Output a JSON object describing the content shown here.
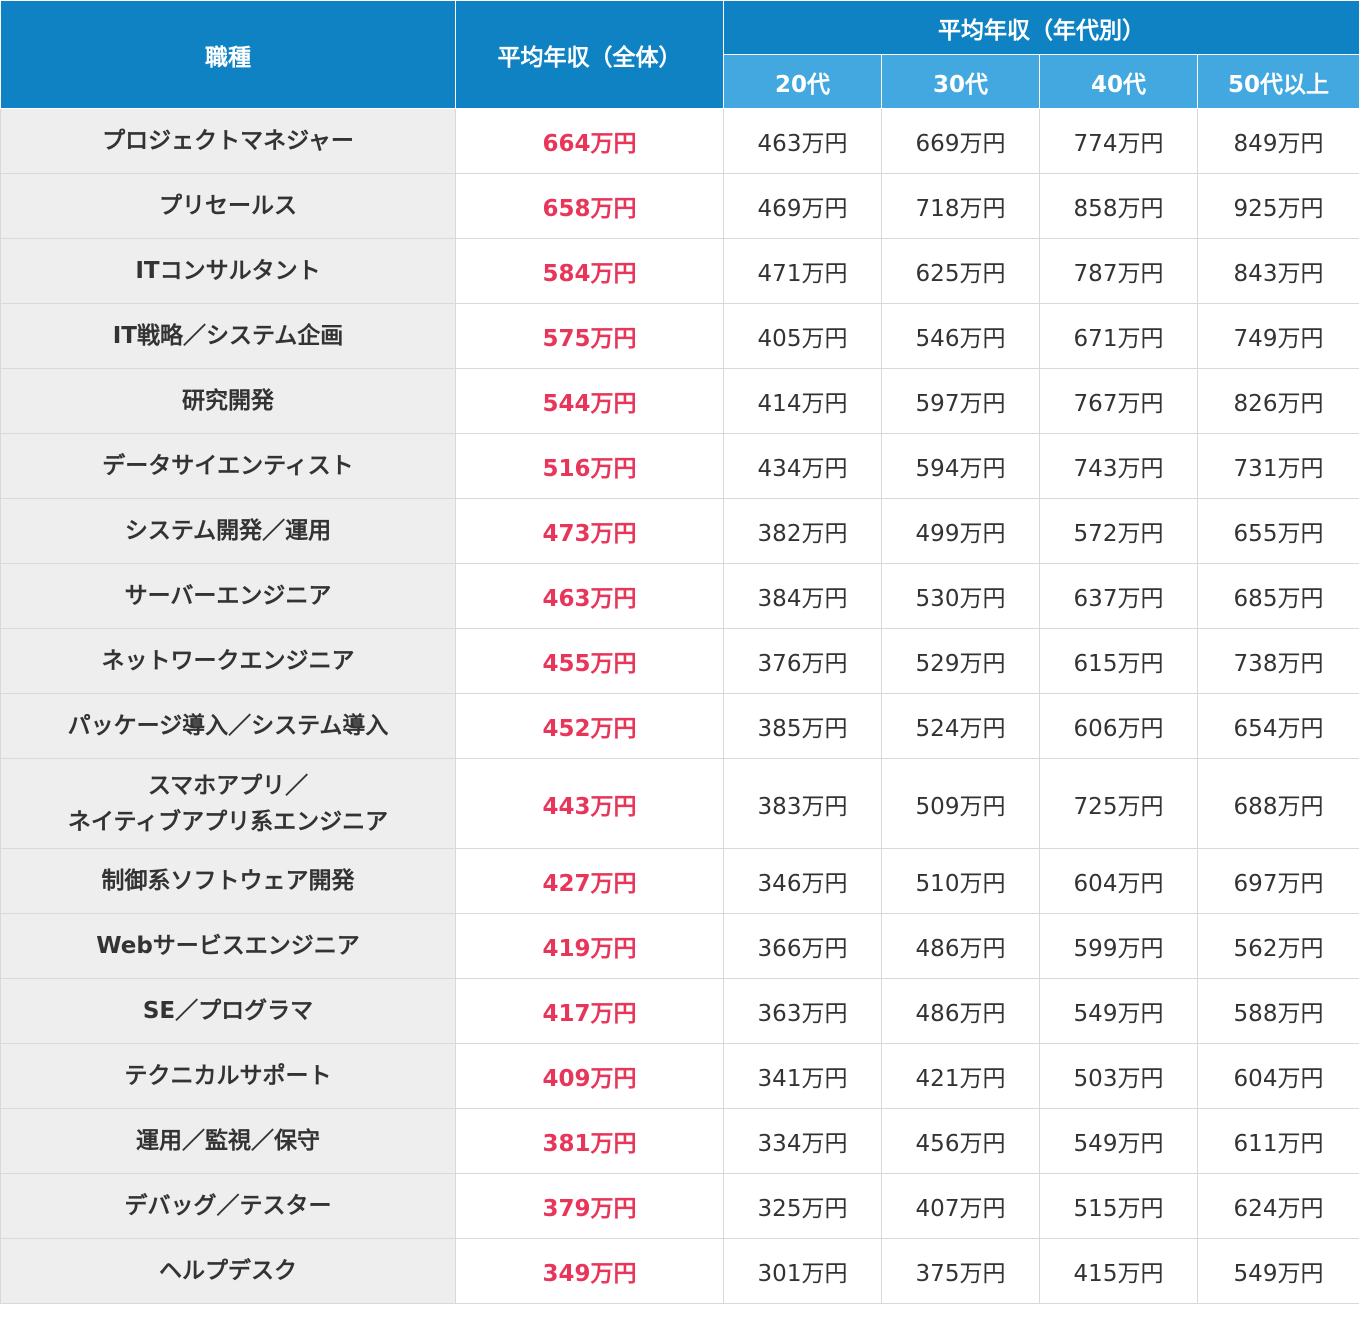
{
  "colors": {
    "header_dark": "#0f82c4",
    "header_light": "#42a8df",
    "header_text": "#ffffff",
    "job_cell_bg": "#eeeeee",
    "average_text": "#e8365b",
    "body_text": "#333333",
    "border": "#d9d9d9"
  },
  "header": {
    "job": "職種",
    "average": "平均年収（全体）",
    "by_age": "平均年収（年代別）",
    "age_20": "20代",
    "age_30": "30代",
    "age_40": "40代",
    "age_50": "50代以上"
  },
  "rows": [
    {
      "job": [
        "プロジェクトマネジャー"
      ],
      "average": "664万円",
      "age_20": "463万円",
      "age_30": "669万円",
      "age_40": "774万円",
      "age_50": "849万円"
    },
    {
      "job": [
        "プリセールス"
      ],
      "average": "658万円",
      "age_20": "469万円",
      "age_30": "718万円",
      "age_40": "858万円",
      "age_50": "925万円"
    },
    {
      "job": [
        "ITコンサルタント"
      ],
      "average": "584万円",
      "age_20": "471万円",
      "age_30": "625万円",
      "age_40": "787万円",
      "age_50": "843万円"
    },
    {
      "job": [
        "IT戦略／システム企画"
      ],
      "average": "575万円",
      "age_20": "405万円",
      "age_30": "546万円",
      "age_40": "671万円",
      "age_50": "749万円"
    },
    {
      "job": [
        "研究開発"
      ],
      "average": "544万円",
      "age_20": "414万円",
      "age_30": "597万円",
      "age_40": "767万円",
      "age_50": "826万円"
    },
    {
      "job": [
        "データサイエンティスト"
      ],
      "average": "516万円",
      "age_20": "434万円",
      "age_30": "594万円",
      "age_40": "743万円",
      "age_50": "731万円"
    },
    {
      "job": [
        "システム開発／運用"
      ],
      "average": "473万円",
      "age_20": "382万円",
      "age_30": "499万円",
      "age_40": "572万円",
      "age_50": "655万円"
    },
    {
      "job": [
        "サーバーエンジニア"
      ],
      "average": "463万円",
      "age_20": "384万円",
      "age_30": "530万円",
      "age_40": "637万円",
      "age_50": "685万円"
    },
    {
      "job": [
        "ネットワークエンジニア"
      ],
      "average": "455万円",
      "age_20": "376万円",
      "age_30": "529万円",
      "age_40": "615万円",
      "age_50": "738万円"
    },
    {
      "job": [
        "パッケージ導入／システム導入"
      ],
      "average": "452万円",
      "age_20": "385万円",
      "age_30": "524万円",
      "age_40": "606万円",
      "age_50": "654万円"
    },
    {
      "job": [
        "スマホアプリ／",
        "ネイティブアプリ系エンジニア"
      ],
      "average": "443万円",
      "age_20": "383万円",
      "age_30": "509万円",
      "age_40": "725万円",
      "age_50": "688万円"
    },
    {
      "job": [
        "制御系ソフトウェア開発"
      ],
      "average": "427万円",
      "age_20": "346万円",
      "age_30": "510万円",
      "age_40": "604万円",
      "age_50": "697万円"
    },
    {
      "job": [
        "Webサービスエンジニア"
      ],
      "average": "419万円",
      "age_20": "366万円",
      "age_30": "486万円",
      "age_40": "599万円",
      "age_50": "562万円"
    },
    {
      "job": [
        "SE／プログラマ"
      ],
      "average": "417万円",
      "age_20": "363万円",
      "age_30": "486万円",
      "age_40": "549万円",
      "age_50": "588万円"
    },
    {
      "job": [
        "テクニカルサポート"
      ],
      "average": "409万円",
      "age_20": "341万円",
      "age_30": "421万円",
      "age_40": "503万円",
      "age_50": "604万円"
    },
    {
      "job": [
        "運用／監視／保守"
      ],
      "average": "381万円",
      "age_20": "334万円",
      "age_30": "456万円",
      "age_40": "549万円",
      "age_50": "611万円"
    },
    {
      "job": [
        "デバッグ／テスター"
      ],
      "average": "379万円",
      "age_20": "325万円",
      "age_30": "407万円",
      "age_40": "515万円",
      "age_50": "624万円"
    },
    {
      "job": [
        "ヘルプデスク"
      ],
      "average": "349万円",
      "age_20": "301万円",
      "age_30": "375万円",
      "age_40": "415万円",
      "age_50": "549万円"
    }
  ]
}
